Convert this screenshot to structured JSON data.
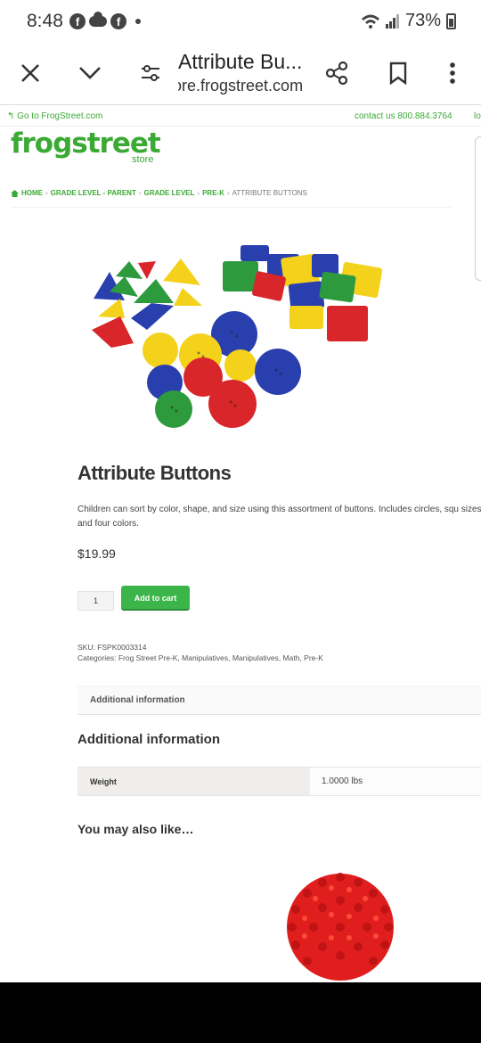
{
  "status": {
    "time": "8:48",
    "battery": "73%"
  },
  "browser": {
    "tab_title": "Attribute Bu...",
    "url": "ore.frogstreet.com"
  },
  "site": {
    "goto": "Go to FrogStreet.com",
    "contact": "contact us 800.884.3764",
    "contact_more": "lo",
    "logo": "frogstreet",
    "logo_sub": "store"
  },
  "breadcrumb": [
    "HOME",
    "GRADE LEVEL - PARENT",
    "GRADE LEVEL",
    "PRE-K",
    "ATTRIBUTE BUTTONS"
  ],
  "product": {
    "title": "Attribute Buttons",
    "description": "Children can sort by color, shape, and size using this assortment of buttons. Includes circles, squ sizes and four colors.",
    "price": "$19.99",
    "qty": "1",
    "add_to_cart": "Add to cart",
    "sku": "SKU: FSPK0003314",
    "categories": "Categories: Frog Street Pre-K, Manipulatives, Manipulatives, Math, Pre-K"
  },
  "tabs": {
    "additional": "Additional information"
  },
  "additional": {
    "heading": "Additional information",
    "rows": [
      {
        "key": "Weight",
        "value": "1.0000 lbs"
      }
    ]
  },
  "related": {
    "heading": "You may also like…"
  }
}
